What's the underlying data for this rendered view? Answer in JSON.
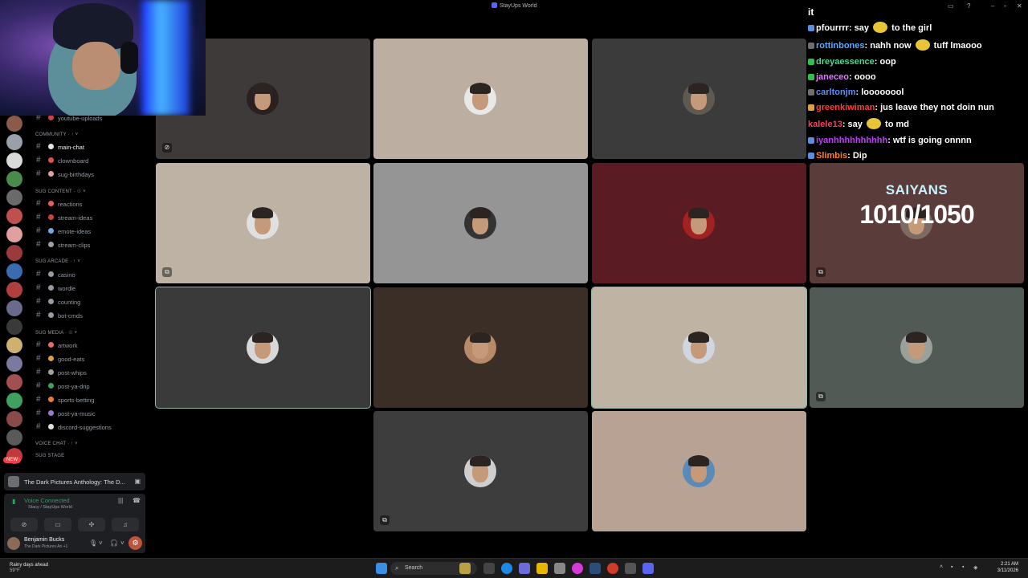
{
  "window": {
    "title": "StayUps World"
  },
  "sidebar": {
    "rows": [
      {
        "type": "channel",
        "label": "youtube-uploads",
        "icon_color": "#d33f3f"
      },
      {
        "type": "category",
        "label": "COMMUNITY · ↑ ˅"
      },
      {
        "type": "channel",
        "label": "main-chat",
        "icon_color": "#e6e6e6",
        "active": true
      },
      {
        "type": "channel",
        "label": "clownboard",
        "icon_color": "#d9534f"
      },
      {
        "type": "channel",
        "label": "sug-birthdays",
        "icon_color": "#e0a0a0"
      },
      {
        "type": "category",
        "label": "SUG CONTENT · ☉ ˅"
      },
      {
        "type": "channel",
        "label": "reactions",
        "icon_color": "#e06060"
      },
      {
        "type": "channel",
        "label": "stream-ideas",
        "icon_color": "#d33f3f"
      },
      {
        "type": "channel",
        "label": "emote-ideas",
        "icon_color": "#7aa6e0"
      },
      {
        "type": "channel",
        "label": "stream-clips",
        "icon_color": "#a0a0a0"
      },
      {
        "type": "category",
        "label": "SUG ARCADE · ↑ ˅"
      },
      {
        "type": "channel",
        "label": "casino",
        "icon_color": "#949ba4"
      },
      {
        "type": "channel",
        "label": "wordle",
        "icon_color": "#949ba4"
      },
      {
        "type": "channel",
        "label": "counting",
        "icon_color": "#949ba4"
      },
      {
        "type": "channel",
        "label": "bot-cmds",
        "icon_color": "#949ba4"
      },
      {
        "type": "category",
        "label": "SUG MEDIA · ☉ ˅"
      },
      {
        "type": "channel",
        "label": "artwork",
        "icon_color": "#e07070"
      },
      {
        "type": "channel",
        "label": "good-eats",
        "icon_color": "#e0a040"
      },
      {
        "type": "channel",
        "label": "post-whips",
        "icon_color": "#a0a0a0"
      },
      {
        "type": "channel",
        "label": "post-ya-drip",
        "icon_color": "#40a060"
      },
      {
        "type": "channel",
        "label": "sports-betting",
        "icon_color": "#e08040"
      },
      {
        "type": "channel",
        "label": "post-ya-music",
        "icon_color": "#9a7ad0"
      },
      {
        "type": "channel",
        "label": "discord-suggestions",
        "icon_color": "#e0e0e0"
      },
      {
        "type": "category",
        "label": "VOICE CHAT · ↑ ˅"
      },
      {
        "type": "category",
        "label": "SUG STAGE"
      }
    ],
    "new_pill": "NEW"
  },
  "bottom": {
    "activity": "The Dark Pictures Anthology: The D...",
    "voice_status": "Voice Connected",
    "voice_sub": "Stacy / StayUps World",
    "user_name": "Benjamin Bucks",
    "user_status": "The Dark Pictures An +1"
  },
  "grid": {
    "tiles": [
      {
        "bg": "#3f3a3a",
        "av": "#2a2020",
        "icon": "⊘"
      },
      {
        "bg": "#bcaea0",
        "av": "#e8e8e8",
        "icon": ""
      },
      {
        "bg": "#3b3b3b",
        "av": "#5e5a52",
        "icon": ""
      },
      {
        "bg": "#bdb2a3",
        "av": "#e0e0e0",
        "icon": "⧉"
      },
      {
        "bg": "#959595",
        "av": "#333333",
        "icon": ""
      },
      {
        "bg": "#5a1c22",
        "av": "#a22222",
        "icon": ""
      },
      {
        "bg": "#5a3c3a",
        "av": "#7e6a62",
        "icon": "⧉",
        "overlay": true
      },
      {
        "bg": "#3a3a3a",
        "av": "#d8d8d8",
        "icon": "",
        "selected": true
      },
      {
        "bg": "#3a2e26",
        "av": "#b88a6a",
        "icon": ""
      },
      {
        "bg": "#bfb4a4",
        "av": "#cfd6e0",
        "icon": "",
        "selected": true
      },
      {
        "bg": "#525a55",
        "av": "#9aa09a",
        "icon": "⧉"
      },
      {
        "bg": "#3d3d3d",
        "av": "#cfcfcf",
        "icon": "⧉"
      },
      {
        "bg": "#b8a294",
        "av": "#5a8ab8",
        "icon": ""
      }
    ]
  },
  "overlay": {
    "saiyans_title": "SAIYANS",
    "saiyans_count": "1010/1050"
  },
  "chat": {
    "header": "it",
    "lines": [
      {
        "user": "pfourrrr",
        "user_color": "#ffffff",
        "text": ": say ",
        "emote": true,
        "text2": " to the girl",
        "badge": "#5b8de0"
      },
      {
        "user": "rottinbones",
        "user_color": "#5aa8ff",
        "text": ": nahh now ",
        "emote": true,
        "text2": " tuff lmaooo",
        "badge": "#6e6e6e"
      },
      {
        "user": "dreyaessence",
        "user_color": "#4ad98c",
        "text": ": oop",
        "emote": false,
        "text2": "",
        "badge": "#2fbf4a"
      },
      {
        "user": "janeceo",
        "user_color": "#e07aff",
        "text": ": oooo",
        "emote": false,
        "text2": "",
        "badge": "#2fbf4a"
      },
      {
        "user": "carltonjm",
        "user_color": "#5a8fff",
        "text": ": loooooool",
        "emote": false,
        "text2": "",
        "badge": "#6e6e6e"
      },
      {
        "user": "greenkiwiman",
        "user_color": "#ff3b3b",
        "text": ": jus leave they not doin nun",
        "emote": false,
        "text2": "",
        "badge": "#e0a040"
      },
      {
        "user": "kalele13",
        "user_color": "#ff3b5c",
        "text": ": say ",
        "emote": true,
        "text2": " to md",
        "badge": ""
      },
      {
        "user": "iyanhhhhhhhhhh",
        "user_color": "#c03bff",
        "text": ": wtf is going onnnn",
        "emote": false,
        "text2": "",
        "badge": "#5b8de0"
      },
      {
        "user": "Slimbis",
        "user_color": "#ff7a2b",
        "text": ": Dip",
        "emote": false,
        "text2": "",
        "badge": "#5b8de0"
      }
    ]
  },
  "taskbar": {
    "weather_title": "Rainy days ahead",
    "weather_temp": "59°F",
    "search": "Search",
    "time": "2:21 AM",
    "date": "3/11/2026"
  }
}
